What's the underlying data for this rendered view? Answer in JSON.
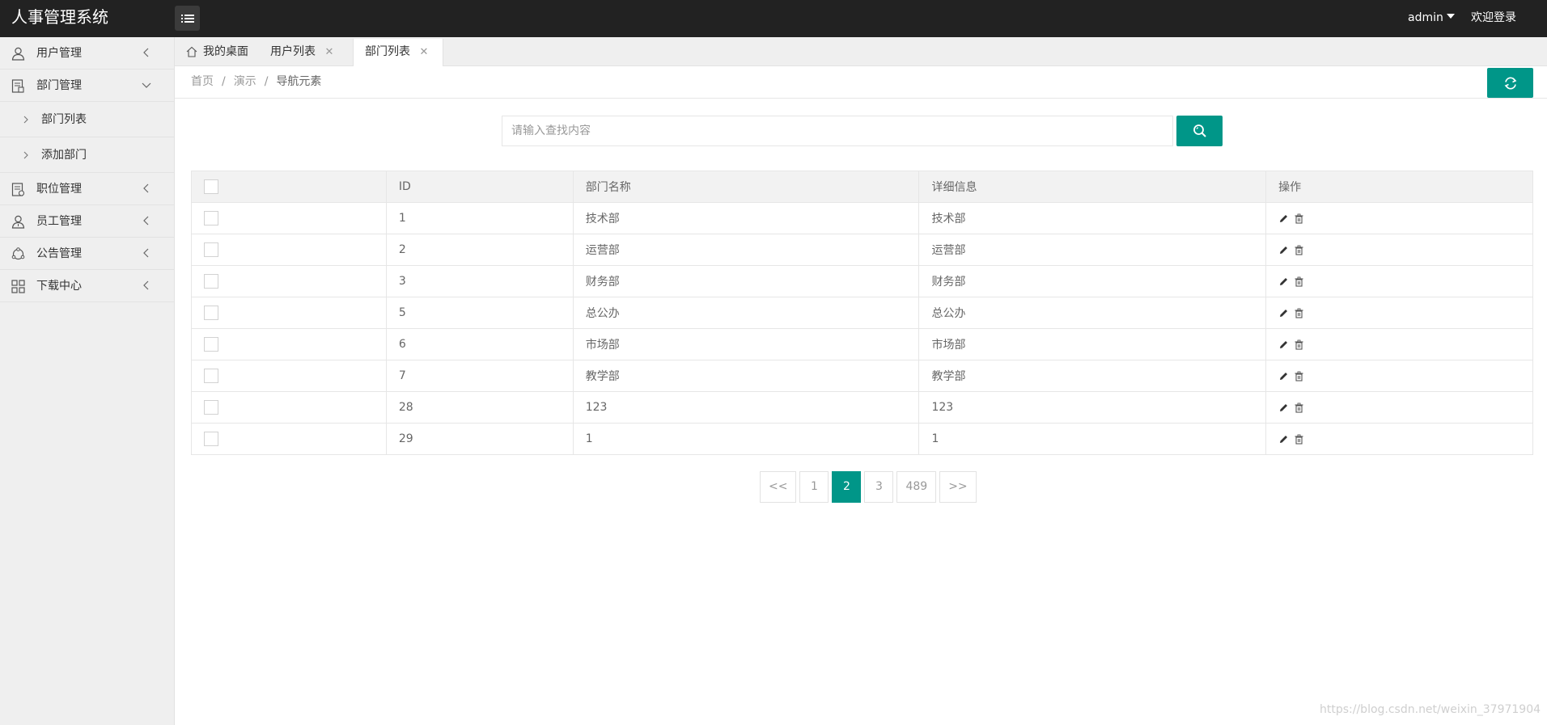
{
  "app": {
    "title": "人事管理系统"
  },
  "header": {
    "user": "admin",
    "welcome": "欢迎登录"
  },
  "sidebar": {
    "items": [
      {
        "label": "用户管理",
        "icon": "user-icon"
      },
      {
        "label": "部门管理",
        "icon": "document-icon",
        "expanded": true,
        "children": [
          {
            "label": "部门列表"
          },
          {
            "label": "添加部门"
          }
        ]
      },
      {
        "label": "职位管理",
        "icon": "briefcase-icon"
      },
      {
        "label": "员工管理",
        "icon": "employee-icon"
      },
      {
        "label": "公告管理",
        "icon": "announcement-icon"
      },
      {
        "label": "下载中心",
        "icon": "grid-icon"
      }
    ]
  },
  "tabs": [
    {
      "label": "我的桌面",
      "icon": "home-icon",
      "active": false
    },
    {
      "label": "用户列表",
      "active": false,
      "closable": true
    },
    {
      "label": "部门列表",
      "active": true,
      "closable": true
    }
  ],
  "breadcrumb": {
    "items": [
      "首页",
      "演示",
      "导航元素"
    ]
  },
  "search": {
    "placeholder": "请输入查找内容"
  },
  "table": {
    "headers": [
      "",
      "ID",
      "部门名称",
      "详细信息",
      "操作"
    ],
    "rows": [
      {
        "id": "1",
        "name": "技术部",
        "detail": "技术部"
      },
      {
        "id": "2",
        "name": "运营部",
        "detail": "运营部"
      },
      {
        "id": "3",
        "name": "财务部",
        "detail": "财务部"
      },
      {
        "id": "5",
        "name": "总公办",
        "detail": "总公办"
      },
      {
        "id": "6",
        "name": "市场部",
        "detail": "市场部"
      },
      {
        "id": "7",
        "name": "教学部",
        "detail": "教学部"
      },
      {
        "id": "28",
        "name": "123",
        "detail": "123"
      },
      {
        "id": "29",
        "name": "1",
        "detail": "1"
      }
    ]
  },
  "pagination": {
    "prev": "<<",
    "pages": [
      "1",
      "2",
      "3",
      "489"
    ],
    "current": "2",
    "next": ">>"
  },
  "watermark": "https://blog.csdn.net/weixin_37971904",
  "colors": {
    "accent": "#009688",
    "header_bg": "#222222",
    "sidebar_bg": "#efefef"
  }
}
